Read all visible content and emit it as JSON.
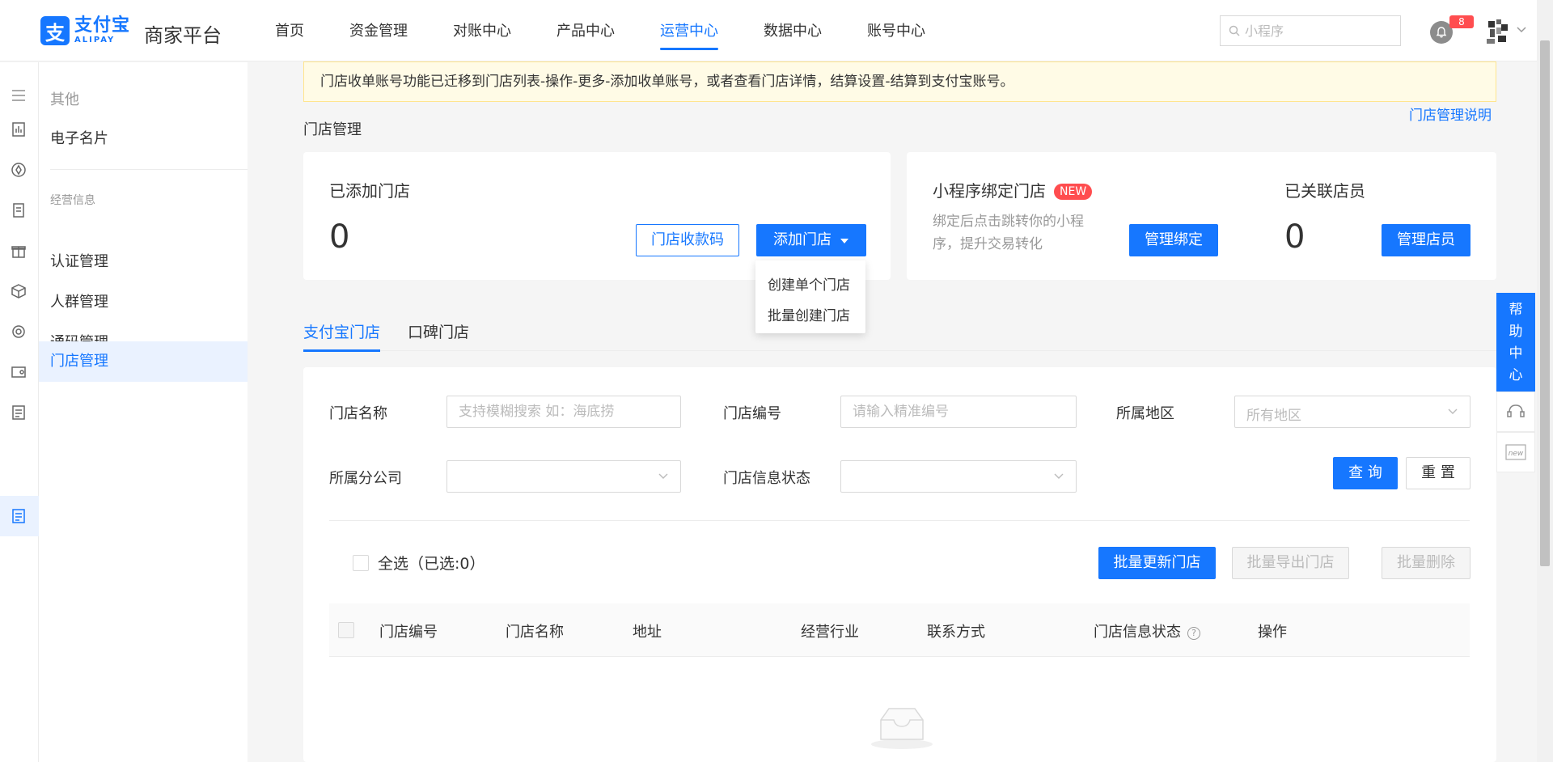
{
  "header": {
    "logo_cn": "支付宝",
    "logo_en": "ALIPAY",
    "logo_glyph": "支",
    "platform": "商家平台",
    "nav": [
      {
        "label": "首页",
        "active": false
      },
      {
        "label": "资金管理",
        "active": false
      },
      {
        "label": "对账中心",
        "active": false
      },
      {
        "label": "产品中心",
        "active": false
      },
      {
        "label": "运营中心",
        "active": true
      },
      {
        "label": "数据中心",
        "active": false
      },
      {
        "label": "账号中心",
        "active": false
      }
    ],
    "search_placeholder": "小程序",
    "notification_count": "8"
  },
  "sidebar": {
    "group_other": "其他",
    "item_card": "电子名片",
    "group_business": "经营信息",
    "items": [
      {
        "label": "认证管理",
        "active": false
      },
      {
        "label": "人群管理",
        "active": false
      },
      {
        "label": "通码管理",
        "active": false
      },
      {
        "label": "门店管理",
        "active": true
      }
    ]
  },
  "notice": "门店收单账号功能已迁移到门店列表-操作-更多-添加收单账号，或者查看门店详情，结算设置-结算到支付宝账号。",
  "page_title": "门店管理",
  "help_link": "门店管理说明",
  "cards": {
    "stores": {
      "title": "已添加门店",
      "count": "0",
      "qr_btn": "门店收款码",
      "add_btn": "添加门店"
    },
    "miniapp": {
      "title": "小程序绑定门店",
      "badge": "NEW",
      "desc": "绑定后点击跳转你的小程序，提升交易转化",
      "btn": "管理绑定"
    },
    "staff": {
      "title": "已关联店员",
      "count": "0",
      "btn": "管理店员"
    }
  },
  "add_dropdown": [
    "创建单个门店",
    "批量创建门店"
  ],
  "tabs": [
    {
      "label": "支付宝门店",
      "active": true
    },
    {
      "label": "口碑门店",
      "active": false
    }
  ],
  "filters": {
    "store_name": {
      "label": "门店名称",
      "placeholder": "支持模糊搜索 如：海底捞"
    },
    "store_code": {
      "label": "门店编号",
      "placeholder": "请输入精准编号"
    },
    "region": {
      "label": "所属地区",
      "placeholder": "所有地区"
    },
    "branch": {
      "label": "所属分公司"
    },
    "info_status": {
      "label": "门店信息状态"
    },
    "query_btn": "查 询",
    "reset_btn": "重 置"
  },
  "actions": {
    "select_all": "全选（已选:0）",
    "bulk_update": "批量更新门店",
    "bulk_export": "批量导出门店",
    "bulk_delete": "批量删除"
  },
  "table_columns": [
    "门店编号",
    "门店名称",
    "地址",
    "经营行业",
    "联系方式",
    "门店信息状态",
    "操作"
  ],
  "float_help": "帮助中心",
  "colors": {
    "primary": "#1677ff",
    "danger": "#ff4d4f",
    "notice_bg": "#fffbe6"
  }
}
